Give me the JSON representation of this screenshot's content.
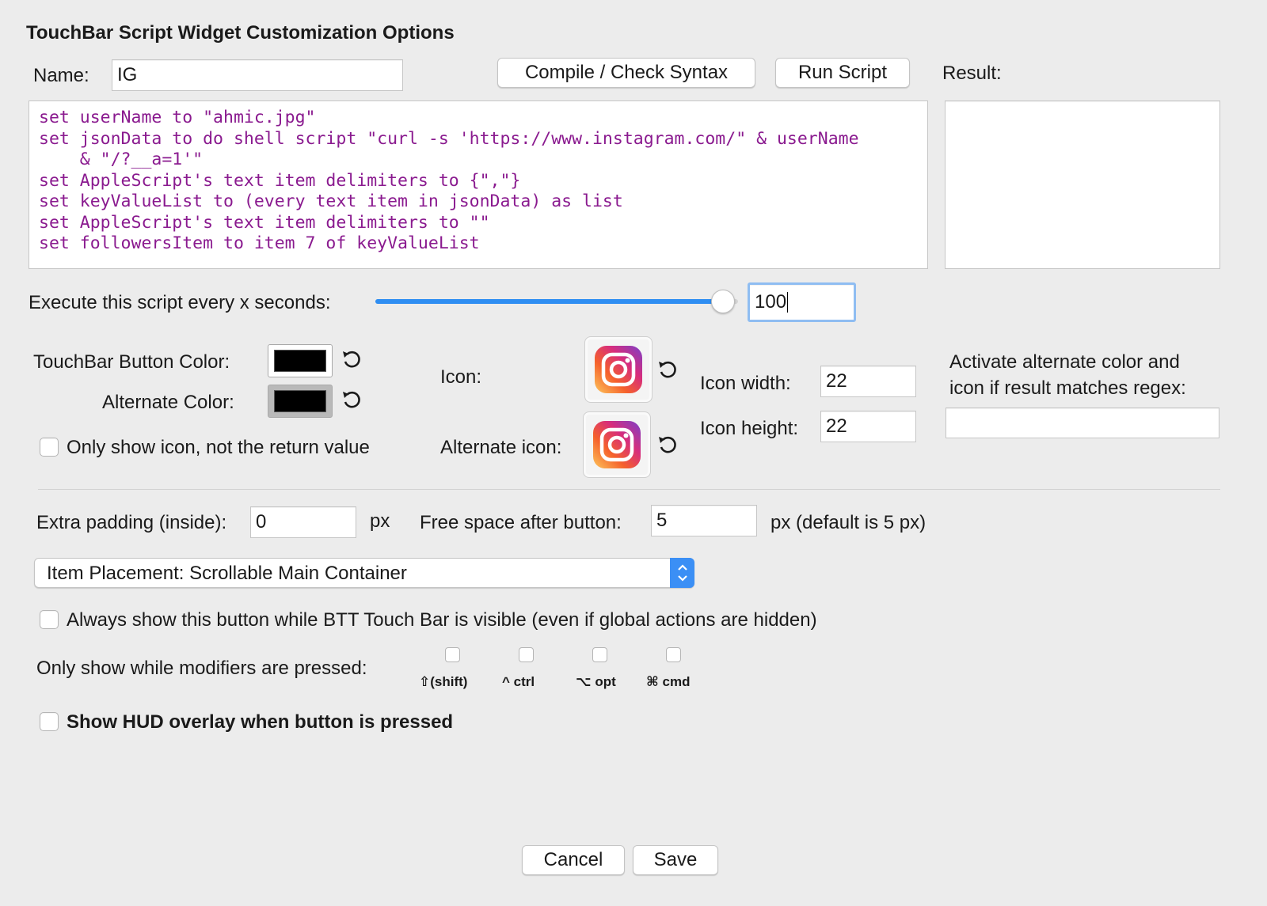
{
  "dialog": {
    "title": "TouchBar Script Widget Customization Options"
  },
  "name": {
    "label": "Name:",
    "value": "IG"
  },
  "buttons": {
    "compile": "Compile / Check Syntax",
    "run": "Run Script",
    "cancel": "Cancel",
    "save": "Save"
  },
  "result": {
    "label": "Result:",
    "value": ""
  },
  "script": {
    "lines": [
      "set userName to \"ahmic.jpg\"",
      "set jsonData to do shell script \"curl -s 'https://www.instagram.com/\" & userName",
      "    & \"/?__a=1'\"",
      "set AppleScript's text item delimiters to {\",\"}",
      "set keyValueList to (every text item in jsonData) as list",
      "set AppleScript's text item delimiters to \"\"",
      "",
      "set followersItem to item 7 of keyValueList"
    ]
  },
  "execute": {
    "label": "Execute this script every x seconds:",
    "value": "100",
    "slider_fraction": 0.99
  },
  "colors": {
    "button_color_label": "TouchBar Button Color:",
    "alternate_color_label": "Alternate Color:",
    "button_color": "#000000",
    "alternate_color": "#000000",
    "accent": "#2f8ef2"
  },
  "icons": {
    "icon_label": "Icon:",
    "alternate_icon_label": "Alternate icon:",
    "icon_name": "instagram-icon",
    "reset_icon_name": "reset-icon"
  },
  "icon_size": {
    "width_label": "Icon width:",
    "width_value": "22",
    "height_label": "Icon height:",
    "height_value": "22"
  },
  "regex": {
    "label_line1": "Activate alternate color and",
    "label_line2": "icon if result matches regex:",
    "value": ""
  },
  "only_icon": {
    "label": "Only show icon, not the return value",
    "checked": false
  },
  "padding": {
    "label": "Extra padding (inside):",
    "value": "0",
    "unit": "px"
  },
  "free_space": {
    "label": "Free space after button:",
    "value": "5",
    "unit": "px (default is 5 px)"
  },
  "placement": {
    "selected": "Item Placement: Scrollable Main Container"
  },
  "always_show": {
    "label": "Always show this button while BTT Touch Bar is visible (even if global actions are hidden)",
    "checked": false
  },
  "modifiers": {
    "label": "Only show while modifiers are pressed:",
    "items": [
      {
        "label": "⇧(shift)",
        "checked": false
      },
      {
        "label": "^ ctrl",
        "checked": false
      },
      {
        "label": "⌥ opt",
        "checked": false
      },
      {
        "label": "⌘ cmd",
        "checked": false
      }
    ]
  },
  "hud": {
    "label": "Show HUD overlay when button is pressed",
    "checked": false
  }
}
